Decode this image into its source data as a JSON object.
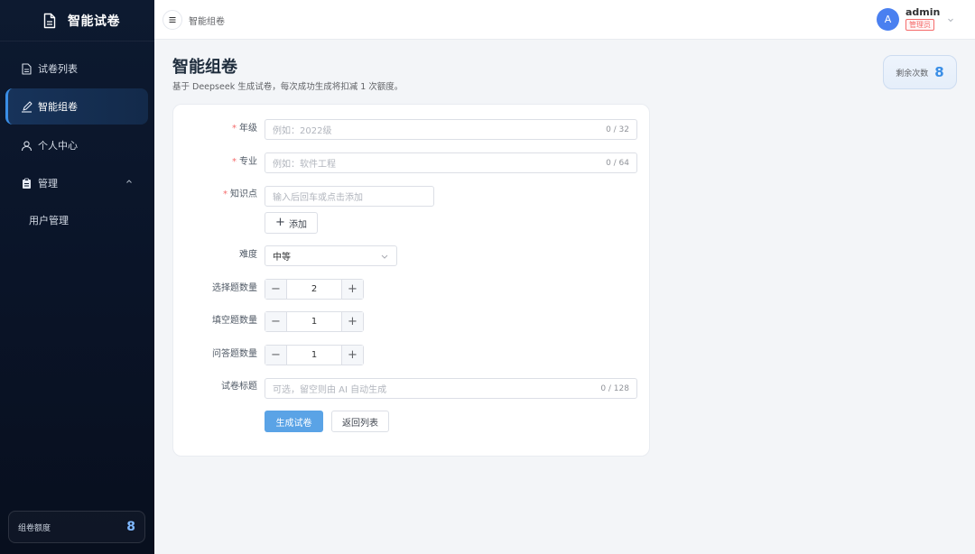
{
  "app": {
    "title": "智能试卷"
  },
  "sidebar": {
    "items": [
      {
        "label": "试卷列表",
        "icon": "document-list-icon"
      },
      {
        "label": "智能组卷",
        "icon": "edit-pen-icon",
        "active": true
      },
      {
        "label": "个人中心",
        "icon": "user-icon"
      },
      {
        "label": "管理",
        "icon": "clipboard-icon",
        "expanded": true
      },
      {
        "label": "用户管理"
      }
    ],
    "quota": {
      "label": "组卷额度",
      "value": "8"
    }
  },
  "header": {
    "breadcrumb": "智能组卷",
    "user": {
      "avatar_letter": "A",
      "name": "admin",
      "role": "管理员"
    }
  },
  "main": {
    "title": "智能组卷",
    "description": "基于 Deepseek 生成试卷，每次成功生成将扣减 1 次额度。",
    "remaining": {
      "label": "剩余次数",
      "value": "8"
    }
  },
  "form": {
    "grade": {
      "label": "年级",
      "required": true,
      "placeholder": "例如：2022级",
      "count": "0 / 32"
    },
    "major": {
      "label": "专业",
      "required": true,
      "placeholder": "例如：软件工程",
      "count": "0 / 64"
    },
    "knowledge": {
      "label": "知识点",
      "required": true,
      "placeholder": "输入后回车或点击添加",
      "add_label": "添加"
    },
    "difficulty": {
      "label": "难度",
      "value": "中等"
    },
    "choice_count": {
      "label": "选择题数量",
      "value": "2"
    },
    "blank_count": {
      "label": "填空题数量",
      "value": "1"
    },
    "qa_count": {
      "label": "问答题数量",
      "value": "1"
    },
    "paper_title": {
      "label": "试卷标题",
      "placeholder": "可选，留空则由 AI 自动生成",
      "count": "0 / 128"
    },
    "submit_label": "生成试卷",
    "back_label": "返回列表"
  },
  "colors": {
    "primary": "#5aa3e6",
    "sidebar_bg": "#0d1a30",
    "accent": "#3a8ee6",
    "required": "#f56c6c"
  }
}
